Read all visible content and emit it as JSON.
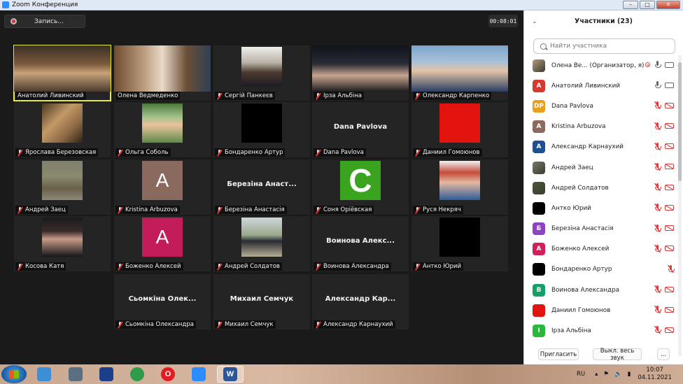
{
  "window": {
    "title": "Zoom Конференция"
  },
  "toolbar": {
    "record_label": "Запись...",
    "timer": "00:08:01"
  },
  "tiles": [
    {
      "name": "Анатолий Ливинский",
      "kind": "photo",
      "style": "photo-man",
      "mic_off": false,
      "active": true
    },
    {
      "name": "Олена Ведмеденко",
      "kind": "photo",
      "style": "photo-woman",
      "mic_off": false
    },
    {
      "name": "Сергій Панкеєв",
      "kind": "photo-center",
      "style": "photo-older",
      "mic_off": true
    },
    {
      "name": "Ірза Альбіна",
      "kind": "photo",
      "style": "photo-girl",
      "mic_off": true
    },
    {
      "name": "Олександр Карпенко",
      "kind": "photo",
      "style": "photo-boy",
      "mic_off": true
    },
    {
      "name": "Ярослава Березовская",
      "kind": "photo-center",
      "style": "photo-pair",
      "mic_off": true
    },
    {
      "name": "Ольга Соболь",
      "kind": "photo-center",
      "style": "photo-lady",
      "mic_off": true
    },
    {
      "name": "Бондаренко Артур",
      "kind": "color",
      "color": "#000000",
      "mic_off": true
    },
    {
      "name": "Dana Pavlova",
      "kind": "text",
      "display": "Dana Pavlova",
      "mic_off": true
    },
    {
      "name": "Даниил Гомоюнов",
      "kind": "color",
      "color": "#e1140f",
      "mic_off": true
    },
    {
      "name": "Андрей Заец",
      "kind": "photo-center",
      "style": "photo-soldier",
      "mic_off": true
    },
    {
      "name": "Kristina Arbuzova",
      "kind": "letter",
      "letter": "A",
      "color": "#8a6a5e",
      "mic_off": true
    },
    {
      "name": "Березіна Анастасія",
      "kind": "text",
      "display": "Березіна Анаст...",
      "mic_off": true
    },
    {
      "name": "Соня Оріёвская",
      "kind": "letter-big",
      "letter": "C",
      "color": "#3ba41e",
      "mic_off": true
    },
    {
      "name": "Руся Некряч",
      "kind": "photo-center",
      "style": "photo-redhair",
      "mic_off": true
    },
    {
      "name": "Косова Катя",
      "kind": "photo-center",
      "style": "photo-dark",
      "mic_off": true
    },
    {
      "name": "Боженко Алексей",
      "kind": "letter",
      "letter": "A",
      "color": "#c21d5a",
      "mic_off": true
    },
    {
      "name": "Андрей Солдатов",
      "kind": "photo-center",
      "style": "photo-walk",
      "mic_off": true
    },
    {
      "name": "Воинова Александра",
      "kind": "text",
      "display": "Воинова Алекс...",
      "mic_off": true
    },
    {
      "name": "Антко Юрий",
      "kind": "color",
      "color": "#000000",
      "mic_off": true
    },
    {
      "name": "Сьомкіна Олександра",
      "kind": "text",
      "display": "Сьомкіна Олек...",
      "mic_off": true
    },
    {
      "name": "Михаил Семчук",
      "kind": "text",
      "display": "Михаил Семчук",
      "mic_off": true
    },
    {
      "name": "Александр Карнаухий",
      "kind": "text",
      "display": "Александр Кар...",
      "mic_off": true
    }
  ],
  "participants_panel": {
    "title": "Участники (23)",
    "search_placeholder": "Найти участника",
    "invite_label": "Пригласить",
    "mute_all_label": "Выкл. весь звук",
    "more_label": "...",
    "items": [
      {
        "name": "Олена Ве... (Организатор, я)",
        "avatar": "",
        "color": "#b69a7e",
        "photo": true,
        "mic": "on",
        "cam": "on",
        "rec": true
      },
      {
        "name": "Анатолий Ливинский",
        "avatar": "A",
        "color": "#d63a2f",
        "mic": "on",
        "cam": "on"
      },
      {
        "name": "Dana Pavlova",
        "avatar": "DP",
        "color": "#e6a01c",
        "mic": "off",
        "cam": "off"
      },
      {
        "name": "Kristina Arbuzova",
        "avatar": "A",
        "color": "#8c6a5c",
        "mic": "off",
        "cam": "off"
      },
      {
        "name": "Александр Карнаухий",
        "avatar": "A",
        "color": "#1f4f8f",
        "mic": "off",
        "cam": "off"
      },
      {
        "name": "Андрей Заец",
        "avatar": "",
        "color": "#7a7a66",
        "photo": true,
        "mic": "off",
        "cam": "off"
      },
      {
        "name": "Андрей Солдатов",
        "avatar": "",
        "color": "#4a5a3a",
        "photo": true,
        "mic": "off",
        "cam": "off"
      },
      {
        "name": "Антко Юрий",
        "avatar": "",
        "color": "#000000",
        "mic": "off",
        "cam": "off"
      },
      {
        "name": "Березіна Анастасія",
        "avatar": "Б",
        "color": "#8c44c4",
        "mic": "off",
        "cam": "off"
      },
      {
        "name": "Боженко Алексей",
        "avatar": "A",
        "color": "#d11f5c",
        "mic": "off",
        "cam": "off"
      },
      {
        "name": "Бондаренко Артур",
        "avatar": "",
        "color": "#000000",
        "mic": "off",
        "cam": "none"
      },
      {
        "name": "Воинова Александра",
        "avatar": "B",
        "color": "#15a06a",
        "mic": "off",
        "cam": "off"
      },
      {
        "name": "Даниил Гомоюнов",
        "avatar": "",
        "color": "#e1140f",
        "mic": "off",
        "cam": "off"
      },
      {
        "name": "Ірза Альбіна",
        "avatar": "I",
        "color": "#28b83c",
        "mic": "off",
        "cam": "off"
      }
    ]
  },
  "taskbar": {
    "items": [
      {
        "name": "windows-explorer",
        "glyph": "",
        "color": "#3c8fd6"
      },
      {
        "name": "media-center",
        "glyph": "",
        "color": "#5b6f83"
      },
      {
        "name": "save-disk",
        "glyph": "",
        "color": "#1c3f8c"
      },
      {
        "name": "chrome",
        "glyph": "",
        "color": "#2e9c4a"
      },
      {
        "name": "opera",
        "glyph": "O",
        "color": "#e31c23"
      },
      {
        "name": "zoom",
        "glyph": "",
        "color": "#2d8cff"
      },
      {
        "name": "word",
        "glyph": "W",
        "color": "#2b579a",
        "active": true
      }
    ],
    "lang": "RU",
    "time": "10:07",
    "date": "04.11.2021"
  }
}
